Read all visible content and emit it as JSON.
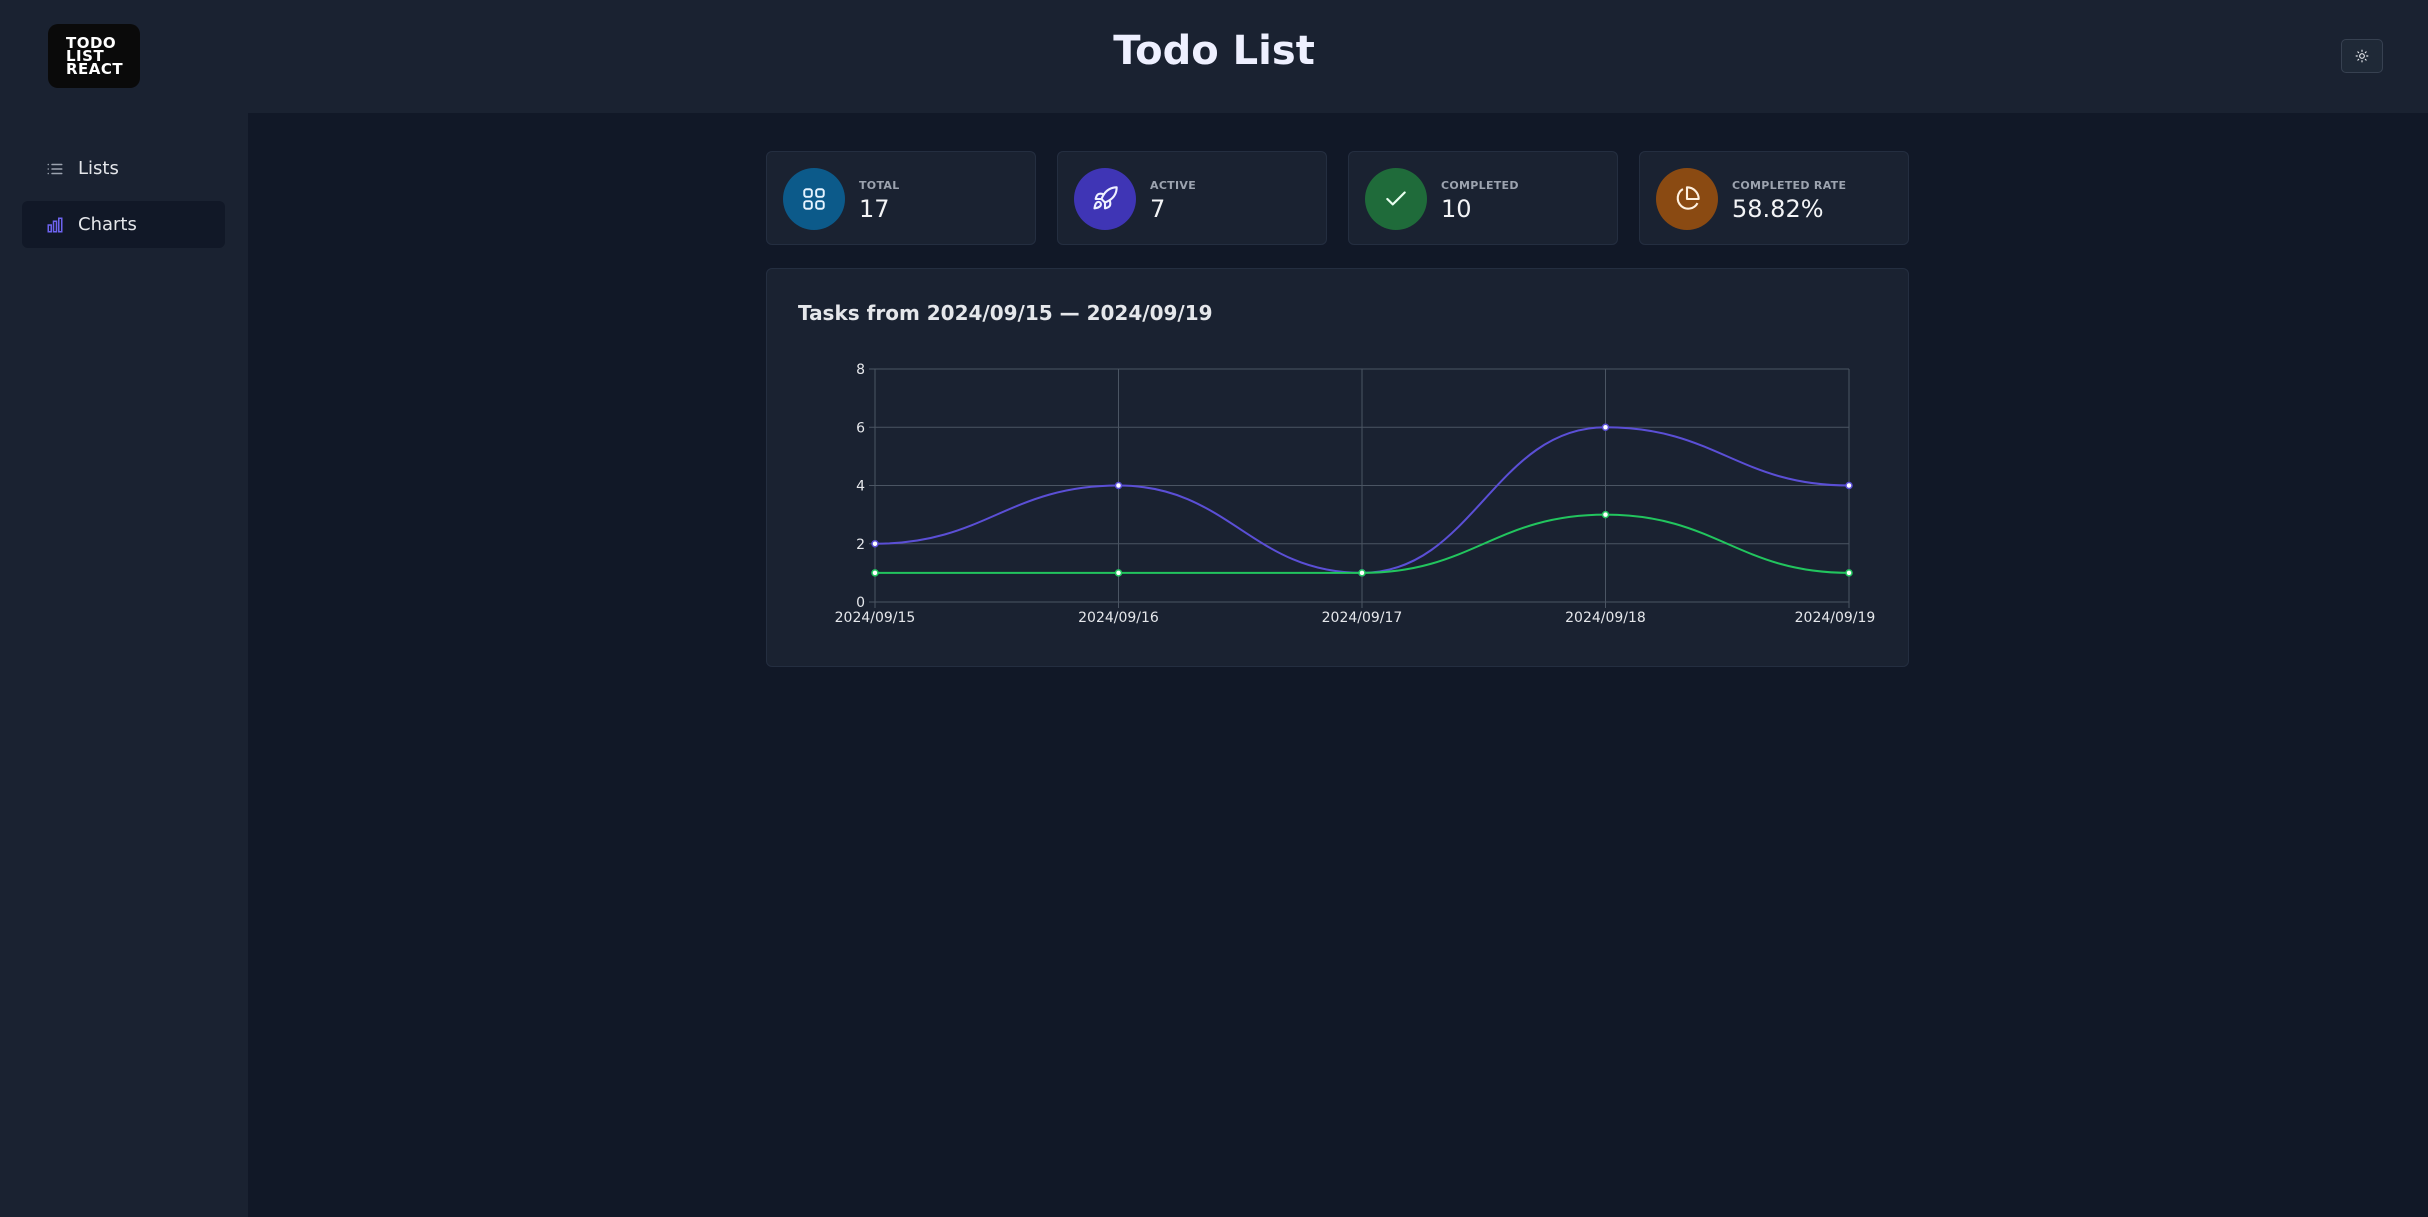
{
  "header": {
    "logo_lines": [
      "TODO",
      "LIST",
      "REACT"
    ],
    "title": "Todo List",
    "theme_icon": "sun-icon"
  },
  "sidebar": {
    "items": [
      {
        "label": "Lists",
        "icon": "list-icon",
        "active": false
      },
      {
        "label": "Charts",
        "icon": "bar-chart-icon",
        "active": true
      }
    ]
  },
  "stats": [
    {
      "label": "TOTAL",
      "value": "17",
      "icon": "grid-icon",
      "color": "#0c5a8a"
    },
    {
      "label": "ACTIVE",
      "value": "7",
      "icon": "rocket-icon",
      "color": "#3f35b5"
    },
    {
      "label": "COMPLETED",
      "value": "10",
      "icon": "check-icon",
      "color": "#1f6b3a"
    },
    {
      "label": "COMPLETED RATE",
      "value": "58.82%",
      "icon": "pie-icon",
      "color": "#8a4a12"
    }
  ],
  "chart_data": {
    "type": "line",
    "title": "Tasks from 2024/09/15 — 2024/09/19",
    "categories": [
      "2024/09/15",
      "2024/09/16",
      "2024/09/17",
      "2024/09/18",
      "2024/09/19"
    ],
    "series": [
      {
        "values": [
          2,
          4,
          1,
          6,
          4
        ],
        "color": "#5b4fd6"
      },
      {
        "values": [
          1,
          1,
          1,
          3,
          1
        ],
        "color": "#22c55e"
      }
    ],
    "ylim": [
      0,
      8
    ],
    "yticks": [
      0,
      2,
      4,
      6,
      8
    ],
    "grid": true,
    "smooth": true
  }
}
